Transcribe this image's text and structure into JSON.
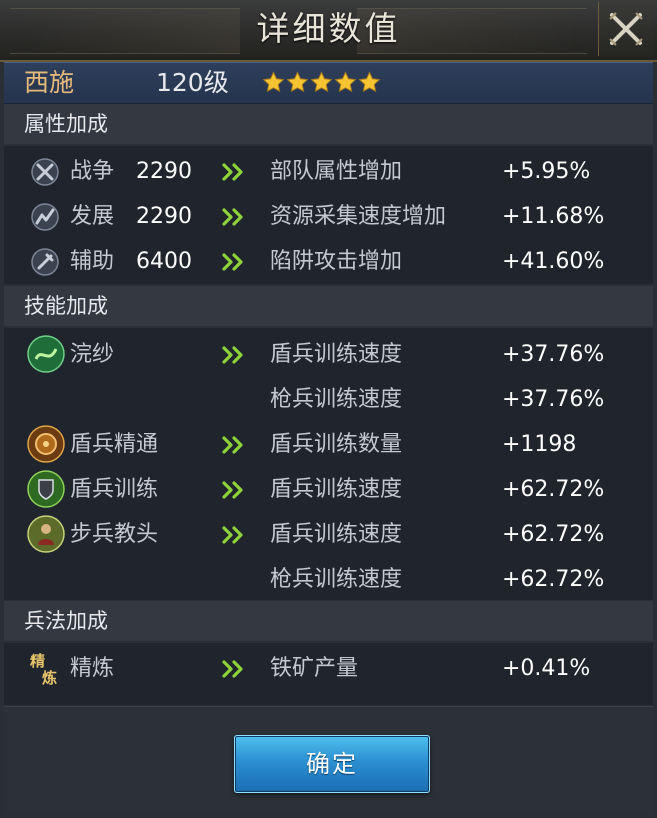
{
  "window": {
    "title": "详细数值"
  },
  "hero": {
    "name": "西施",
    "level": "120级",
    "stars": 5
  },
  "sections": {
    "attributes": {
      "title": "属性加成",
      "rows": [
        {
          "icon": "crossed-swords-icon",
          "name": "战争",
          "value": "2290",
          "effect": "部队属性增加",
          "bonus": "+5.95%"
        },
        {
          "icon": "development-icon",
          "name": "发展",
          "value": "2290",
          "effect": "资源采集速度增加",
          "bonus": "+11.68%"
        },
        {
          "icon": "support-icon",
          "name": "辅助",
          "value": "6400",
          "effect": "陷阱攻击增加",
          "bonus": "+41.60%"
        }
      ]
    },
    "skills": {
      "title": "技能加成",
      "rows": [
        {
          "icon": "huansha-skill-icon",
          "name": "浣纱",
          "effect": "盾兵训练速度",
          "bonus": "+37.76%"
        },
        {
          "icon": "",
          "name": "",
          "effect": "枪兵训练速度",
          "bonus": "+37.76%"
        },
        {
          "icon": "shield-mastery-skill-icon",
          "name": "盾兵精通",
          "effect": "盾兵训练数量",
          "bonus": "+1198"
        },
        {
          "icon": "shield-training-skill-icon",
          "name": "盾兵训练",
          "effect": "盾兵训练速度",
          "bonus": "+62.72%"
        },
        {
          "icon": "infantry-instructor-skill-icon",
          "name": "步兵教头",
          "effect": "盾兵训练速度",
          "bonus": "+62.72%"
        },
        {
          "icon": "",
          "name": "",
          "effect": "枪兵训练速度",
          "bonus": "+62.72%"
        }
      ]
    },
    "tactics": {
      "title": "兵法加成",
      "rows": [
        {
          "icon": "refine-calligraphy-icon",
          "icon_text": "精炼",
          "name": "精炼",
          "effect": "铁矿产量",
          "bonus": "+0.41%"
        }
      ]
    }
  },
  "footer": {
    "confirm_label": "确定"
  },
  "colors": {
    "hero_name": "#e7b97a",
    "accent_green_arrow": "#8fd33a",
    "button_blue": "#2b8fd0",
    "star_gold": "#f7c531"
  }
}
